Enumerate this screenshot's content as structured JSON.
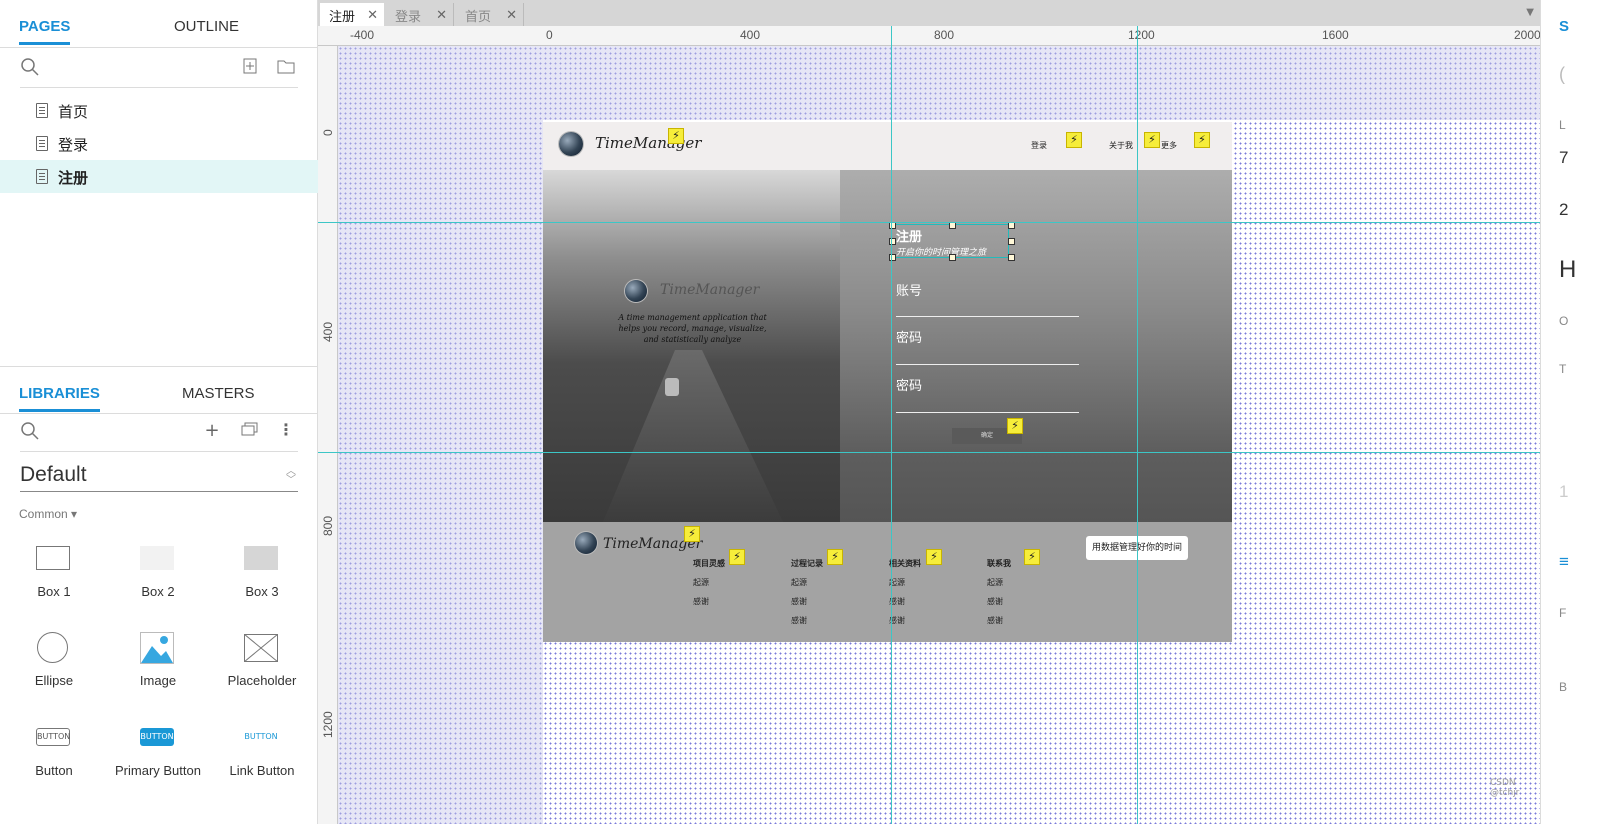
{
  "left_panel": {
    "tabs": [
      "PAGES",
      "OUTLINE"
    ],
    "pages": [
      "首页",
      "登录",
      "注册"
    ],
    "lib_tabs": [
      "LIBRARIES",
      "MASTERS"
    ],
    "library_name": "Default",
    "section": "Common",
    "widgets": [
      "Box 1",
      "Box 2",
      "Box 3",
      "Ellipse",
      "Image",
      "Placeholder",
      "Button",
      "Primary Button",
      "Link Button"
    ],
    "button_caption": "BUTTON"
  },
  "doc_tabs": [
    "注册",
    "登录",
    "首页"
  ],
  "ruler_top": [
    "-400",
    "0",
    "400",
    "800",
    "1200",
    "1600",
    "2000"
  ],
  "ruler_left": [
    "0",
    "400",
    "800",
    "1200"
  ],
  "mock": {
    "brand": "TimeManager",
    "nav": [
      "登录",
      "关于我",
      "更多"
    ],
    "tagline": "A time management application that helps you record, manage, visualize, and statistically analyze",
    "form_title": "注册",
    "form_subtitle": "开启你的时间管理之旅",
    "fields": [
      "账号",
      "密码",
      "密码"
    ],
    "submit": "确定",
    "footer_cols": [
      {
        "title": "项目灵感",
        "items": [
          "起源",
          "感谢"
        ]
      },
      {
        "title": "过程记录",
        "items": [
          "起源",
          "感谢",
          "感谢"
        ]
      },
      {
        "title": "相关资料",
        "items": [
          "起源",
          "感谢",
          "感谢"
        ]
      },
      {
        "title": "联系我",
        "items": [
          "起源",
          "感谢",
          "感谢"
        ]
      }
    ],
    "footer_button": "用数据管理好你的时间"
  },
  "right_panel": {
    "partial": [
      "S",
      "(",
      "L",
      "7",
      "2",
      "H",
      "O",
      "T",
      "1",
      "F",
      "B"
    ]
  },
  "watermark": "CSDN @tchjr"
}
